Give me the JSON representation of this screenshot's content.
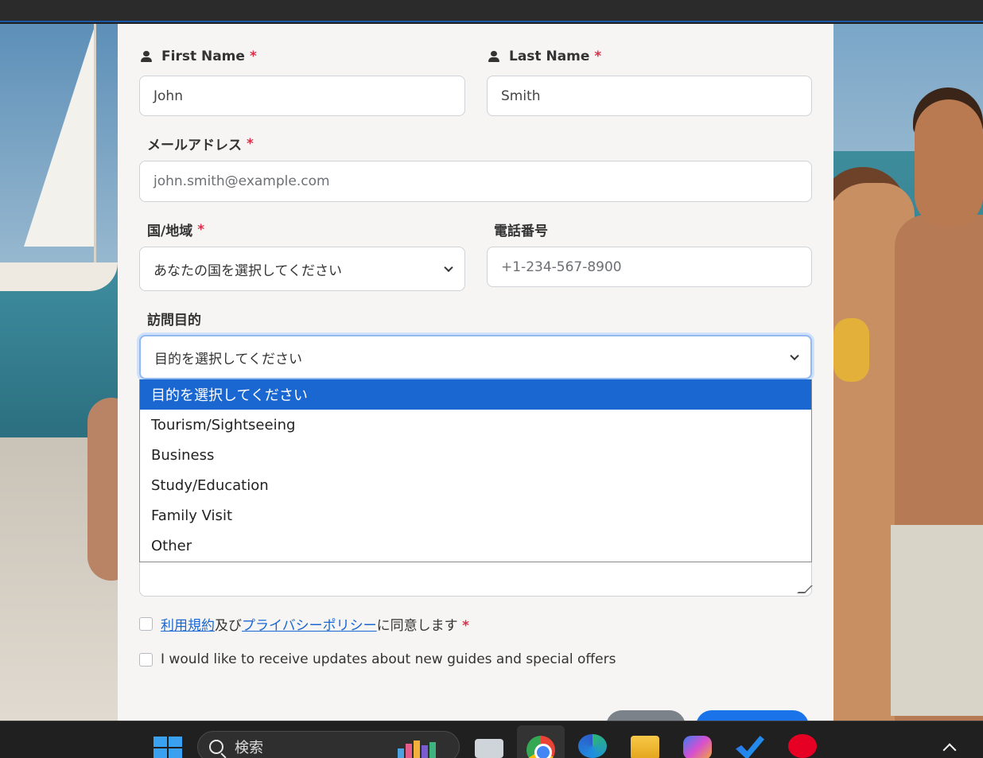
{
  "form": {
    "first_name": {
      "label": "First Name",
      "required": "*",
      "value": "John"
    },
    "last_name": {
      "label": "Last Name",
      "required": "*",
      "value": "Smith"
    },
    "email": {
      "label": "メールアドレス",
      "required": "*",
      "placeholder": "john.smith@example.com"
    },
    "country": {
      "label": "国/地域",
      "required": "*",
      "selected": "あなたの国を選択してください"
    },
    "phone": {
      "label": "電話番号",
      "placeholder": "+1-234-567-8900"
    },
    "purpose": {
      "label": "訪問目的",
      "selected": "目的を選択してください",
      "options": [
        "目的を選択してください",
        "Tourism/Sightseeing",
        "Business",
        "Study/Education",
        "Family Visit",
        "Other"
      ]
    },
    "terms": {
      "link1": "利用規約",
      "mid": "及び",
      "link2": "プライバシーポリシー",
      "suffix": "に同意します",
      "required": "*"
    },
    "updates": {
      "label": "I would like to receive updates about new guides and special offers"
    }
  },
  "taskbar": {
    "search_label": "検索"
  },
  "colors": {
    "accent": "#1a67d2",
    "required": "#d9304a"
  }
}
